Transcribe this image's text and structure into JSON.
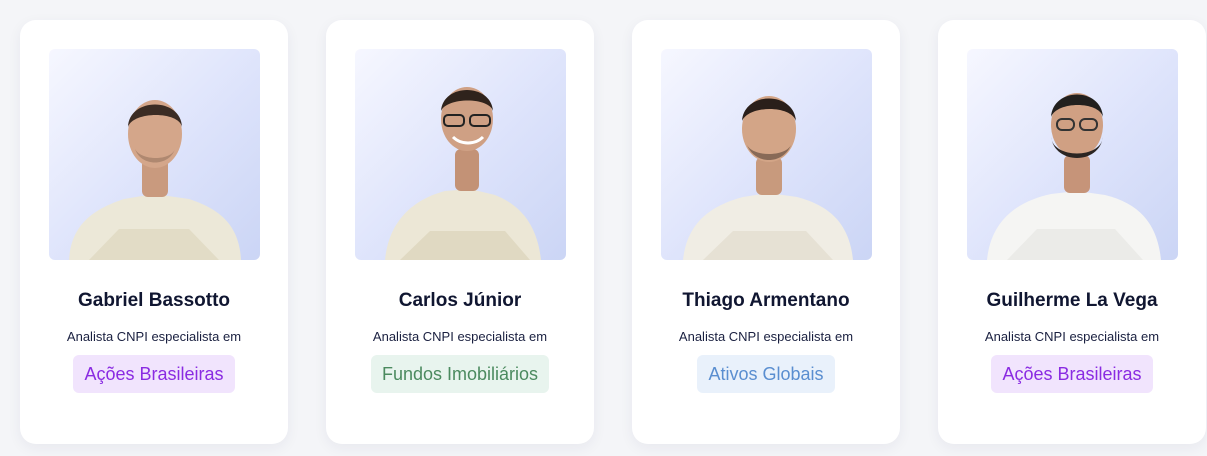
{
  "cards": [
    {
      "name": "Gabriel Bassotto",
      "role": "Analista CNPI especialista em",
      "tag": "Ações Brasileiras",
      "tag_color": "#8a2be2",
      "tag_bg": "#f1e4fd",
      "photo_icon": "person-photo"
    },
    {
      "name": "Carlos Júnior",
      "role": "Analista CNPI especialista em",
      "tag": "Fundos Imobiliários",
      "tag_color": "#4b8a5f",
      "tag_bg": "#e8f4ee",
      "photo_icon": "person-photo"
    },
    {
      "name": "Thiago Armentano",
      "role": "Analista CNPI especialista em",
      "tag": "Ativos Globais",
      "tag_color": "#5a8ed0",
      "tag_bg": "#e9f1fb",
      "photo_icon": "person-photo"
    },
    {
      "name": "Guilherme La Vega",
      "role": "Analista CNPI especialista em",
      "tag": "Ações Brasileiras",
      "tag_color": "#8a2be2",
      "tag_bg": "#f1e4fd",
      "photo_icon": "person-photo"
    }
  ]
}
